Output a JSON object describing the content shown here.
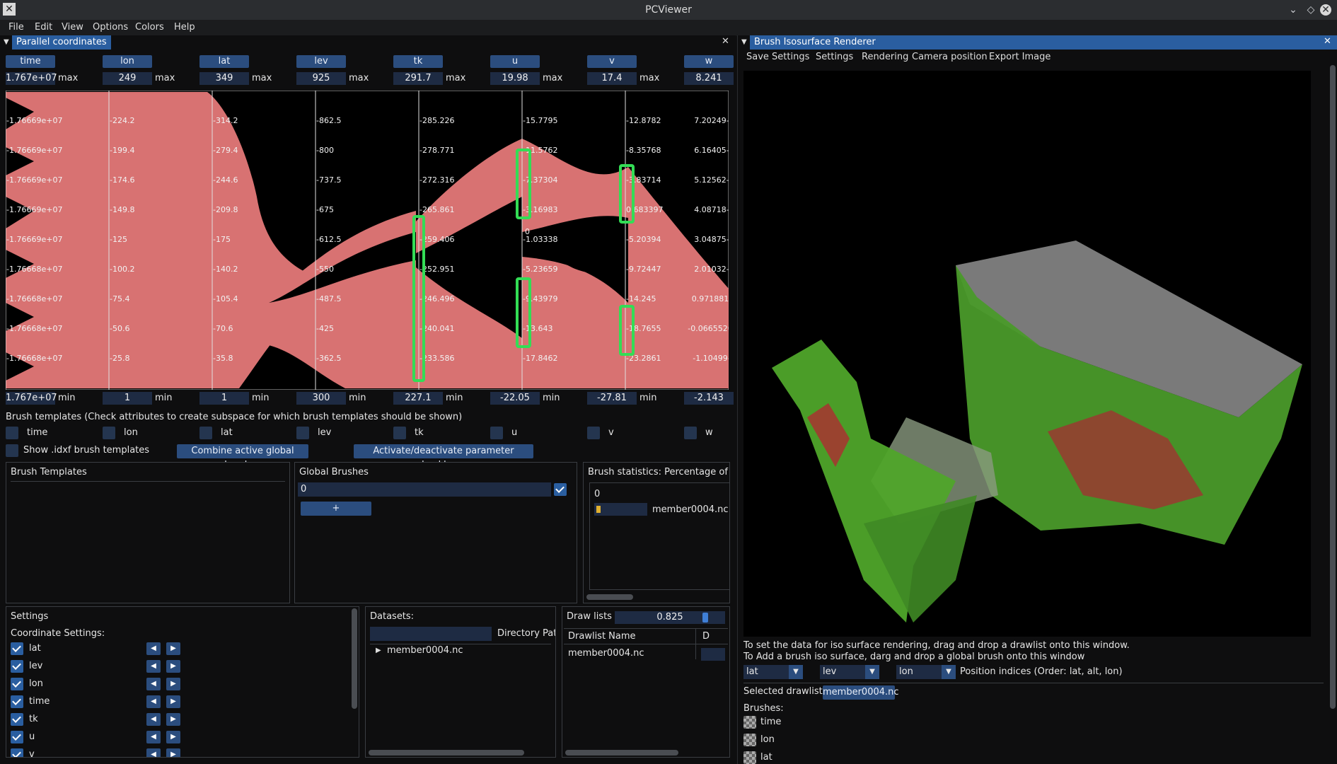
{
  "app": {
    "title": "PCViewer"
  },
  "menu": [
    "File",
    "Edit",
    "View",
    "Options",
    "Colors",
    "Help"
  ],
  "pc_window": {
    "title": "Parallel coordinates",
    "attributes": [
      {
        "name": "time",
        "max": "1.767e+07",
        "min": "1.767e+07",
        "ticks": [
          "-1.76669e+07",
          "-1.76669e+07",
          "-1.76669e+07",
          "-1.76669e+07",
          "-1.76669e+07",
          "-1.76668e+07",
          "-1.76668e+07",
          "-1.76668e+07",
          "-1.76668e+07"
        ]
      },
      {
        "name": "lon",
        "max": "249",
        "min": "1",
        "ticks": [
          "-224.2",
          "-199.4",
          "-174.6",
          "-149.8",
          "-125",
          "-100.2",
          "-75.4",
          "-50.6",
          "-25.8"
        ]
      },
      {
        "name": "lat",
        "max": "349",
        "min": "1",
        "ticks": [
          "-314.2",
          "-279.4",
          "-244.6",
          "-209.8",
          "-175",
          "-140.2",
          "-105.4",
          "-70.6",
          "-35.8"
        ]
      },
      {
        "name": "lev",
        "max": "925",
        "min": "300",
        "ticks": [
          "-862.5",
          "-800",
          "-737.5",
          "-675",
          "-612.5",
          "-550",
          "-487.5",
          "-425",
          "-362.5"
        ]
      },
      {
        "name": "tk",
        "max": "291.7",
        "min": "227.1",
        "ticks": [
          "-285.226",
          "-278.771",
          "-272.316",
          "-265.861",
          "-259.406",
          "-252.951",
          "-246.496",
          "-240.041",
          "-233.586"
        ]
      },
      {
        "name": "u",
        "max": "19.98",
        "min": "-22.05",
        "ticks": [
          "-15.7795",
          "-11.5762",
          "-7.37304",
          "-3.16983",
          "-1.03338",
          "-5.23659",
          "-9.43979",
          "-13.643",
          "-17.8462"
        ]
      },
      {
        "name": "v",
        "max": "17.4",
        "min": "-27.81",
        "ticks": [
          "-12.8782",
          "-8.35768",
          "-3.83714",
          "0.683397",
          "-5.20394",
          "-9.72447",
          "-14.245",
          "-18.7655",
          "-23.2861"
        ]
      },
      {
        "name": "w",
        "max": "8.241",
        "min": "-2.143",
        "ticks": [
          "7.20249-",
          "6.16405-",
          "5.12562-",
          "4.08718-",
          "3.04875-",
          "2.01032-",
          "0.971881-",
          "-0.0665520-",
          "-1.10499-"
        ]
      }
    ],
    "max_label": "max",
    "min_label": "min",
    "u_zero_label": "0",
    "brush_templates_hint": "Brush templates (Check attributes to create subspace for which brush templates should be shown)",
    "show_idxf": "Show .idxf brush templates",
    "combine_btn": "Combine active global brushes",
    "activate_btn": "Activate/deactivate parameter checkboxes"
  },
  "brush_templates": {
    "title": "Brush Templates"
  },
  "global_brushes": {
    "title": "Global Brushes",
    "item": "0",
    "add": "+"
  },
  "brush_stats": {
    "title": "Brush statistics: Percentage of line",
    "group": "0",
    "entry": "member0004.nc"
  },
  "settings": {
    "title": "Settings",
    "coord_title": "Coordinate Settings:",
    "items": [
      "lat",
      "lev",
      "lon",
      "time",
      "tk",
      "u",
      "v"
    ]
  },
  "datasets": {
    "title": "Datasets:",
    "dir_label": "Directory Path",
    "dataset": "member0004.nc"
  },
  "drawlists": {
    "title": "Draw lists",
    "slider_value": "0.825",
    "col_name": "Drawlist Name",
    "col_d": "D",
    "row": "member0004.nc"
  },
  "iso": {
    "title": "Brush Isosurface Renderer",
    "menu": [
      "Save Settings",
      "Settings",
      "Rendering",
      "Camera position",
      "Export Image"
    ],
    "hint1": "To set the data for iso surface rendering, drag and drop a drawlist onto this window.",
    "hint2": "To Add a brush iso surface, darg and drop a global brush onto this window",
    "dropdowns": [
      "lat",
      "lev",
      "lon"
    ],
    "position_label": "Position indices (Order: lat, alt, lon)",
    "selected_label": "Selected drawlist:",
    "selected_value": "member0004.nc",
    "brushes_label": "Brushes:",
    "brushes": [
      "time",
      "lon",
      "lat"
    ]
  },
  "colors": {
    "accent": "#2a5ea0",
    "line": "#d97474",
    "brush": "#33dd55"
  }
}
